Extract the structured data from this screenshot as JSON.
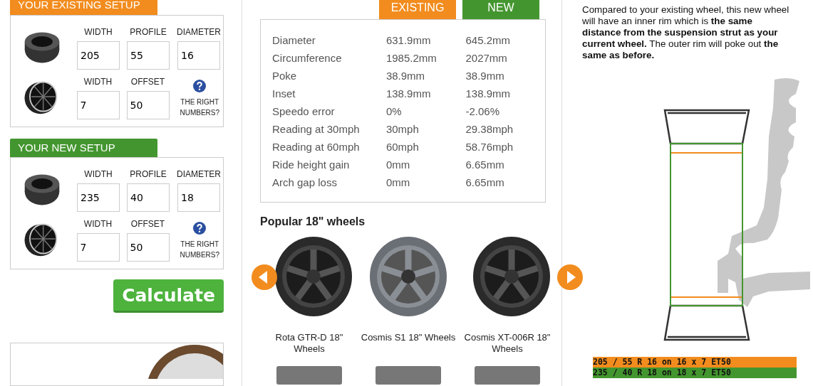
{
  "setups": [
    {
      "title": "YOUR EXISTING SETUP",
      "color": "#f28c1e",
      "tyre_fields": [
        {
          "label": "WIDTH",
          "value": "205"
        },
        {
          "label": "PROFILE",
          "value": "55"
        },
        {
          "label": "DIAMETER",
          "value": "16"
        }
      ],
      "wheel_fields": [
        {
          "label": "WIDTH",
          "value": "7"
        },
        {
          "label": "OFFSET",
          "value": "50"
        }
      ],
      "help": "THE RIGHT NUMBERS?"
    },
    {
      "title": "YOUR NEW SETUP",
      "color": "#43962f",
      "tyre_fields": [
        {
          "label": "WIDTH",
          "value": "235"
        },
        {
          "label": "PROFILE",
          "value": "40"
        },
        {
          "label": "DIAMETER",
          "value": "18"
        }
      ],
      "wheel_fields": [
        {
          "label": "WIDTH",
          "value": "7"
        },
        {
          "label": "OFFSET",
          "value": "50"
        }
      ],
      "help": "THE RIGHT NUMBERS?"
    }
  ],
  "calculate_button": "Calculate",
  "results": {
    "columns": [
      {
        "label": "EXISTING",
        "color": "#f28c1e"
      },
      {
        "label": "NEW",
        "color": "#43962f"
      }
    ],
    "rows": [
      {
        "label": "Diameter",
        "values": [
          "631.9mm",
          "645.2mm"
        ]
      },
      {
        "label": "Circumference",
        "values": [
          "1985.2mm",
          "2027mm"
        ]
      },
      {
        "label": "Poke",
        "values": [
          "38.9mm",
          "38.9mm"
        ]
      },
      {
        "label": "Inset",
        "values": [
          "138.9mm",
          "138.9mm"
        ]
      },
      {
        "label": "Speedo error",
        "values": [
          "0%",
          "-2.06%"
        ]
      },
      {
        "label": "Reading at 30mph",
        "values": [
          "30mph",
          "29.38mph"
        ]
      },
      {
        "label": "Reading at 60mph",
        "values": [
          "60mph",
          "58.76mph"
        ]
      },
      {
        "label": "Ride height gain",
        "values": [
          "0mm",
          "6.65mm"
        ]
      },
      {
        "label": "Arch gap loss",
        "values": [
          "0mm",
          "6.65mm"
        ]
      }
    ]
  },
  "popular": {
    "title": "Popular 18\" wheels",
    "items": [
      {
        "name": "Rota GTR-D 18\" Wheels"
      },
      {
        "name": "Cosmis S1 18\" Wheels"
      },
      {
        "name": "Cosmis XT-006R 18\" Wheels"
      }
    ]
  },
  "summary": "Compared to your existing wheel, this new wheel will have an inner rim which is **the same distance from the suspension strut as your current wheel.** The outer rim will poke out **the same as before.**",
  "legend": [
    {
      "text": "205 / 55 R 16 on 16 x 7 ET50",
      "color": "#f28c1e"
    },
    {
      "text": "235 / 40 R 18 on 18 x 7 ET50",
      "color": "#43962f"
    }
  ]
}
